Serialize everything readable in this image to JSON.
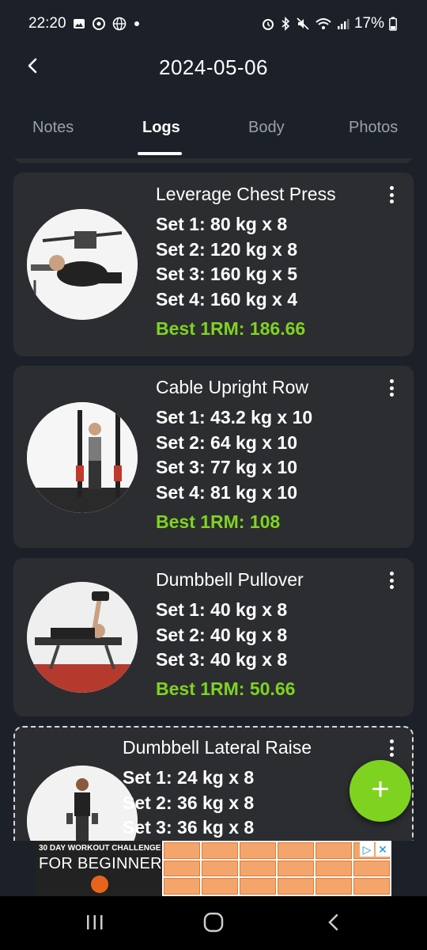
{
  "status_bar": {
    "time": "22:20",
    "battery": "17%",
    "left_icons": [
      "image-icon",
      "whatsapp-icon",
      "globe-icon",
      "dot-icon"
    ],
    "right_icons": [
      "alarm-icon",
      "bluetooth-icon",
      "mute-icon",
      "wifi-icon",
      "signal-icon",
      "battery-icon"
    ]
  },
  "header": {
    "title": "2024-05-06",
    "back_icon": "chevron-left-icon"
  },
  "tabs": [
    {
      "label": "Notes",
      "active": false
    },
    {
      "label": "Logs",
      "active": true
    },
    {
      "label": "Body",
      "active": false
    },
    {
      "label": "Photos",
      "active": false
    }
  ],
  "logs": [
    {
      "name": "Leverage Chest Press",
      "sets": [
        "Set 1: 80 kg x 8",
        "Set 2: 120 kg x 8",
        "Set 3: 160 kg x 5",
        "Set 4: 160 kg x 4"
      ],
      "best": "Best 1RM: 186.66"
    },
    {
      "name": "Cable Upright Row",
      "sets": [
        "Set 1: 43.2 kg x 10",
        "Set 2: 64 kg x 10",
        "Set 3: 77 kg x 10",
        "Set 4: 81 kg x 10"
      ],
      "best": "Best 1RM: 108"
    },
    {
      "name": "Dumbbell Pullover",
      "sets": [
        "Set 1: 40 kg x 8",
        "Set 2: 40 kg x 8",
        "Set 3: 40 kg x 8"
      ],
      "best": "Best 1RM: 50.66"
    },
    {
      "name": "Dumbbell Lateral Raise",
      "sets": [
        "Set 1: 24 kg x 8",
        "Set 2: 36 kg x 8",
        "Set 3: 36 kg x 8"
      ],
      "best": ""
    }
  ],
  "fab": {
    "label": "+"
  },
  "ad": {
    "line1": "30 DAY WORKOUT CHALLENGE",
    "line2": "FOR BEGINNERS"
  },
  "colors": {
    "background": "#1c2129",
    "card": "#2c2d30",
    "accent_green": "#7ed321"
  }
}
